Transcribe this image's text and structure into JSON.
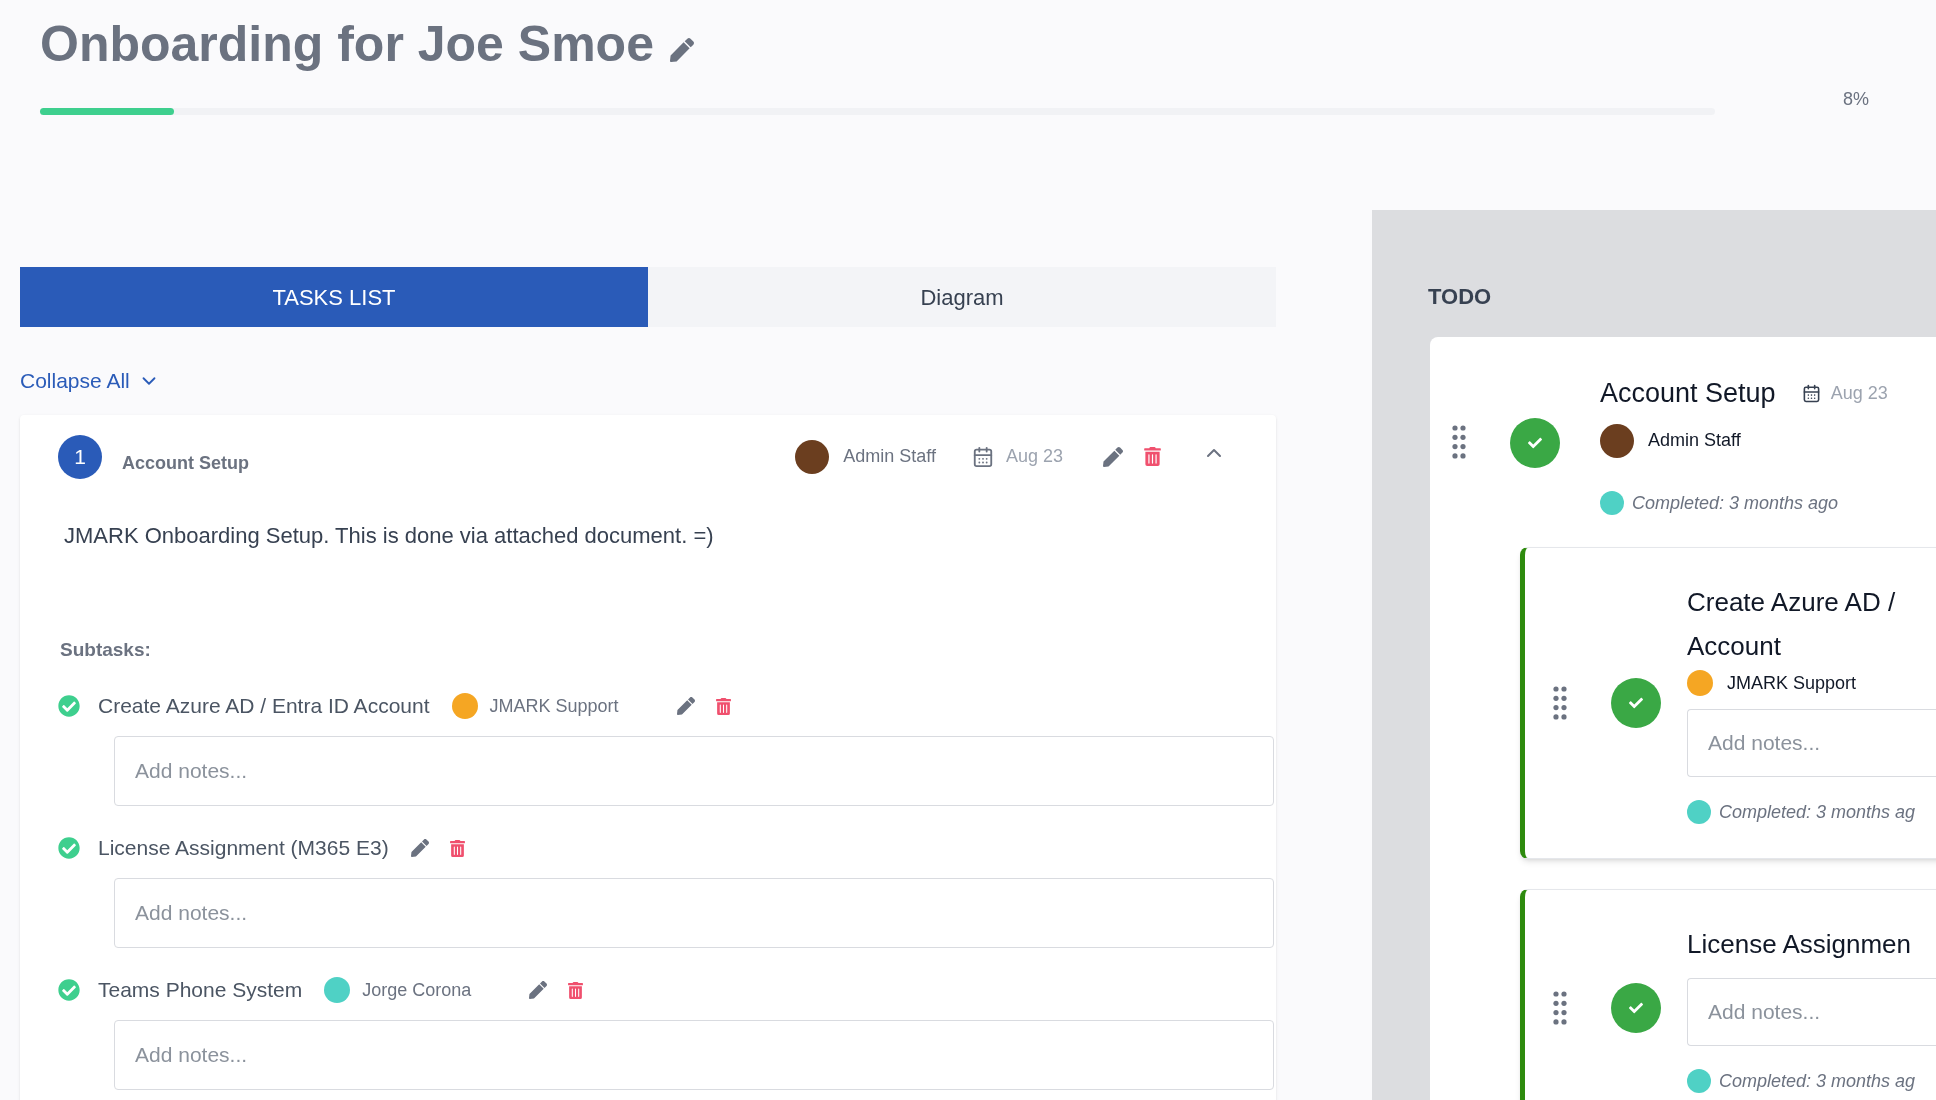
{
  "title": "Onboarding for Joe Smoe",
  "progress": {
    "level": 0.08,
    "reading": "8%"
  },
  "tabs": [
    {
      "label": "TASKS LIST",
      "selected": true
    },
    {
      "label": "Diagram",
      "selected": false
    }
  ],
  "collapse_all": "Collapse All",
  "task": {
    "number": "1",
    "name": "Account Setup",
    "assignee": {
      "name": "Admin Staff",
      "color": "#6b3e1f"
    },
    "due": "Aug 23",
    "expanded": true,
    "description": "JMARK Onboarding Setup. This is done via attached document. =)",
    "subtasks_label": "Subtasks:",
    "subtasks": [
      {
        "name": "Create Azure AD / Entra ID Account",
        "checked": true,
        "assignee": {
          "name": "JMARK Support",
          "color": "#f5a623"
        },
        "placeholder": "Add notes..."
      },
      {
        "name": "License Assignment (M365 E3)",
        "checked": true,
        "placeholder": "Add notes..."
      },
      {
        "name": "Teams Phone System",
        "checked": true,
        "assignee": {
          "name": "Jorge Corona",
          "color": "#4fd1c5"
        },
        "placeholder": "Add notes..."
      }
    ]
  },
  "board": {
    "column": "TODO",
    "card": {
      "title": "Account Setup",
      "due": "Aug 23",
      "done": true,
      "assignee": {
        "name": "Admin Staff",
        "color": "#6b3e1f"
      },
      "completed": {
        "text": "Completed: 3 months ago",
        "color": "#4fd1c5"
      },
      "subtasks": [
        {
          "title_lines": [
            "Create Azure AD /",
            "Account"
          ],
          "done": true,
          "assignee": {
            "name": "JMARK Support",
            "color": "#f5a623"
          },
          "placeholder": "Add notes...",
          "completed": {
            "text": "Completed: 3 months ag",
            "color": "#4fd1c5"
          }
        },
        {
          "title_lines": [
            "License Assignmen"
          ],
          "done": true,
          "placeholder": "Add notes...",
          "completed": {
            "text": "Completed: 3 months ag",
            "color": "#4fd1c5"
          }
        }
      ]
    }
  }
}
